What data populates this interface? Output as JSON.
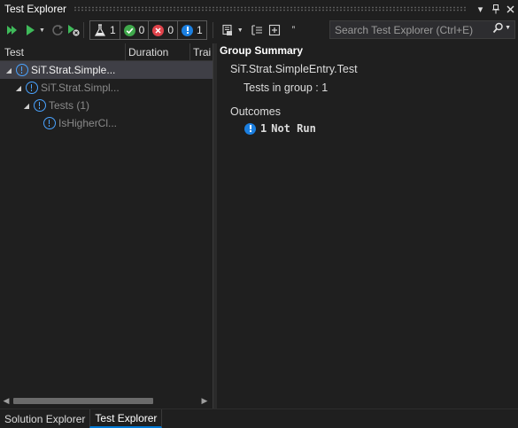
{
  "window": {
    "title": "Test Explorer"
  },
  "toolbar": {
    "counts": {
      "total": "1",
      "passed": "0",
      "failed": "0",
      "not_run": "1"
    },
    "search_placeholder": "Search Test Explorer (Ctrl+E)"
  },
  "columns": {
    "test": "Test",
    "duration": "Duration",
    "traits": "Trai"
  },
  "tree": [
    {
      "label": "SiT.Strat.Simple...",
      "level": 0,
      "expanded": true,
      "selected": true,
      "icon": "warning-icon"
    },
    {
      "label": "SiT.Strat.Simpl...",
      "level": 1,
      "expanded": true,
      "selected": false,
      "icon": "warning-icon"
    },
    {
      "label": "Tests  (1)",
      "level": 2,
      "expanded": true,
      "selected": false,
      "icon": "warning-icon"
    },
    {
      "label": "IsHigherCl...",
      "level": 3,
      "expanded": false,
      "selected": false,
      "icon": "warning-icon"
    }
  ],
  "group_summary": {
    "title": "Group Summary",
    "name": "SiT.Strat.SimpleEntry.Test",
    "tests_in_group": "Tests in group : 1",
    "outcomes_label": "Outcomes",
    "outcome_count": "1",
    "outcome_text": "Not Run"
  },
  "bottom_tabs": [
    {
      "label": "Solution Explorer",
      "active": false
    },
    {
      "label": "Test Explorer",
      "active": true
    }
  ],
  "colors": {
    "background": "#1f1f1f",
    "selection": "#3f3f46",
    "info_blue": "#1b7fe0",
    "pass_green": "#3fa84b",
    "fail_red": "#e0434b",
    "accent": "#0078d4"
  }
}
